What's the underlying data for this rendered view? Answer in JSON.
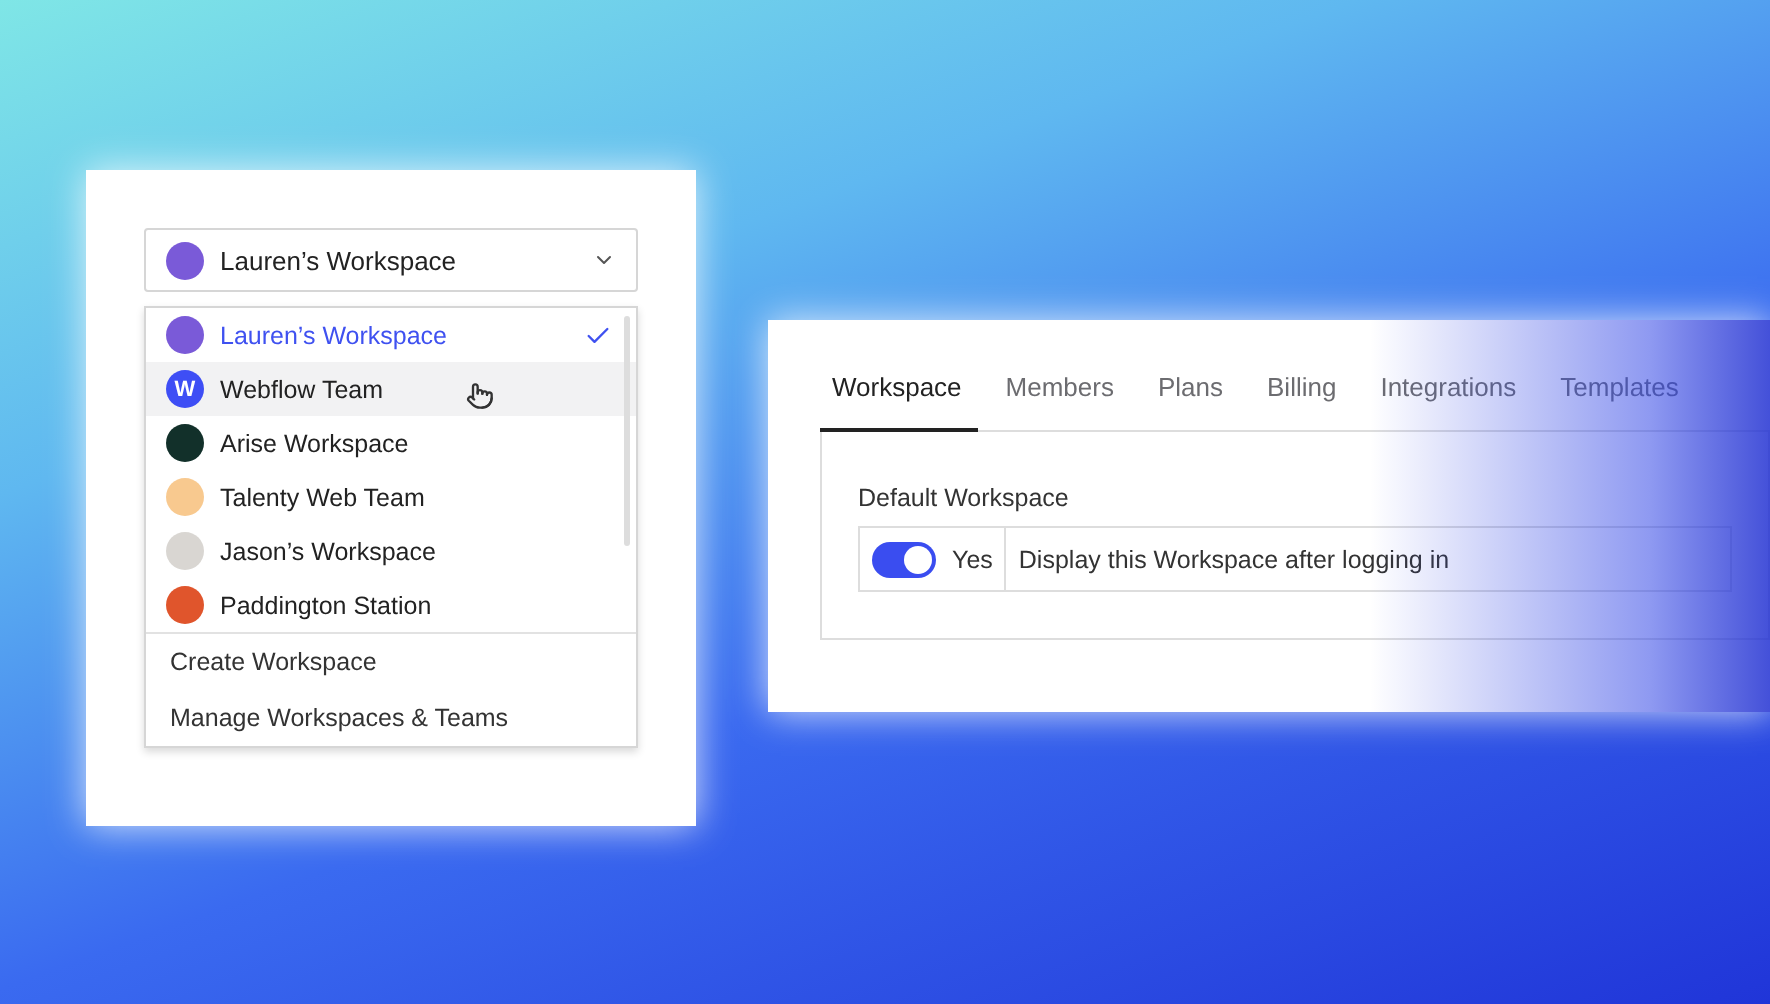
{
  "workspace_picker": {
    "current": "Lauren’s Workspace",
    "items": [
      {
        "label": "Lauren’s Workspace",
        "selected": true,
        "highlighted": false,
        "color": "#7a5ad8"
      },
      {
        "label": "Webflow Team",
        "selected": false,
        "highlighted": true,
        "color": "#3e4ef5",
        "initial": "W"
      },
      {
        "label": "Arise Workspace",
        "selected": false,
        "highlighted": false,
        "color": "#12302a"
      },
      {
        "label": "Talenty Web Team",
        "selected": false,
        "highlighted": false,
        "color": "#f8c98f"
      },
      {
        "label": "Jason’s Workspace",
        "selected": false,
        "highlighted": false,
        "color": "#d9d6d2"
      },
      {
        "label": "Paddington Station",
        "selected": false,
        "highlighted": false,
        "color": "#e0552c"
      }
    ],
    "actions": [
      "Create Workspace",
      "Manage Workspaces & Teams"
    ]
  },
  "settings": {
    "tabs": [
      {
        "label": "Workspace",
        "selected": true
      },
      {
        "label": "Members",
        "selected": false
      },
      {
        "label": "Plans",
        "selected": false
      },
      {
        "label": "Billing",
        "selected": false
      },
      {
        "label": "Integrations",
        "selected": false
      },
      {
        "label": "Templates",
        "selected": false
      }
    ],
    "field_label": "Default Workspace",
    "toggle": {
      "on": true,
      "label": "Yes"
    },
    "description": "Display this Workspace after logging in"
  }
}
